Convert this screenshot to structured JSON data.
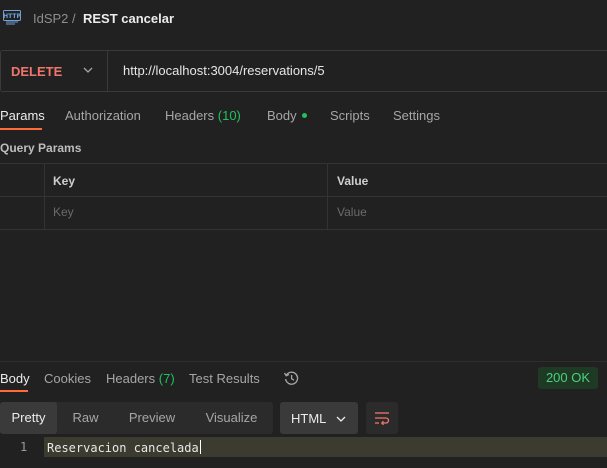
{
  "breadcrumb": {
    "icon": "http-request-icon",
    "collection": "IdSP2",
    "separator": "/",
    "request_name": "REST cancelar"
  },
  "request": {
    "method": "DELETE",
    "url": "http://localhost:3004/reservations/5",
    "tabs": {
      "params": "Params",
      "authorization": "Authorization",
      "headers": "Headers",
      "headers_count": "(10)",
      "body": "Body",
      "scripts": "Scripts",
      "settings": "Settings"
    },
    "active_tab": "Params"
  },
  "query_params": {
    "title": "Query Params",
    "columns": {
      "key": "Key",
      "value": "Value"
    },
    "placeholder": {
      "key": "Key",
      "value": "Value"
    }
  },
  "response": {
    "tabs": {
      "body": "Body",
      "cookies": "Cookies",
      "headers": "Headers",
      "headers_count": "(7)",
      "test_results": "Test Results"
    },
    "active_tab": "Body",
    "status": "200 OK",
    "format_buttons": [
      "Pretty",
      "Raw",
      "Preview",
      "Visualize"
    ],
    "active_format": "Pretty",
    "language": "HTML",
    "lines": [
      {
        "number": "1",
        "text": "Reservacion cancelada"
      }
    ]
  },
  "colors": {
    "accent": "#ff6c37",
    "delete_method": "#f0766b",
    "success": "#22c15e"
  }
}
